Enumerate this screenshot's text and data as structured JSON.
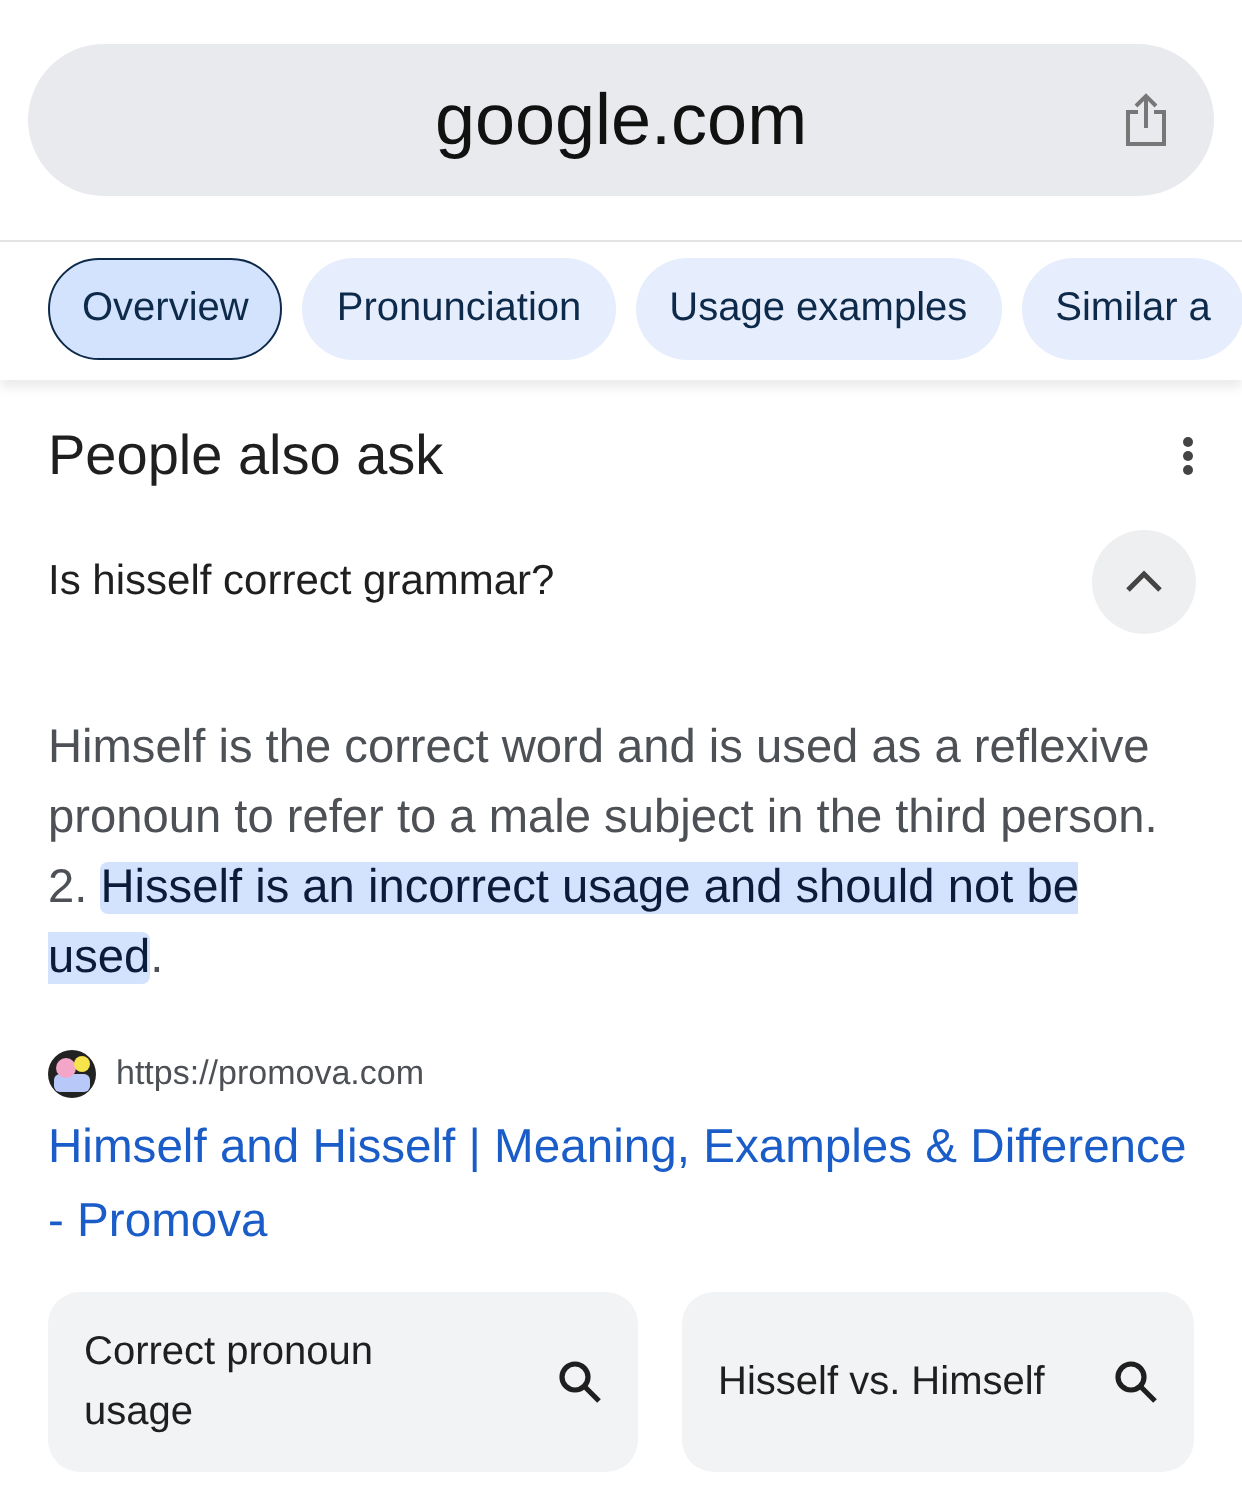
{
  "address_bar": {
    "url": "google.com"
  },
  "tabs": [
    {
      "label": "Overview",
      "selected": true
    },
    {
      "label": "Pronunciation",
      "selected": false
    },
    {
      "label": "Usage examples",
      "selected": false
    },
    {
      "label": "Similar a",
      "selected": false
    }
  ],
  "section": {
    "title": "People also ask"
  },
  "question": {
    "text": "Is hisself correct grammar?",
    "expanded": true
  },
  "answer": {
    "parts": [
      {
        "text": "Himself is the correct word and is used as a reflexive pronoun to refer to a male subject in the third person. 2. ",
        "highlighted": false
      },
      {
        "text": "Hisself is an incorrect usage and should not be used",
        "highlighted": true
      },
      {
        "text": ".",
        "highlighted": false
      }
    ]
  },
  "source": {
    "url": "https://promova.com",
    "title": "Himself and Hisself | Meaning, Examples & Difference - Promova"
  },
  "related_searches": [
    {
      "text": "Correct pronoun usage"
    },
    {
      "text": "Hisself vs. Himself"
    }
  ]
}
